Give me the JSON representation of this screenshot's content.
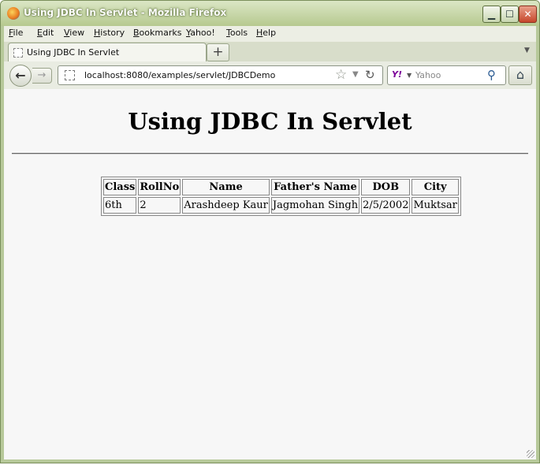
{
  "window": {
    "title": "Using JDBC In Servlet - Mozilla Firefox",
    "controls": {
      "minimize": "▁",
      "maximize": "☐",
      "close": "✕"
    }
  },
  "menu": [
    {
      "accel": "F",
      "rest": "ile"
    },
    {
      "accel": "E",
      "rest": "dit"
    },
    {
      "accel": "V",
      "rest": "iew"
    },
    {
      "accel": "H",
      "rest": "istory"
    },
    {
      "accel": "B",
      "rest": "ookmarks"
    },
    {
      "accel": "Y",
      "rest": "ahoo!"
    },
    {
      "accel": "T",
      "rest": "ools"
    },
    {
      "accel": "H",
      "rest": "elp"
    }
  ],
  "tabs": [
    {
      "title": "Using JDBC In Servlet",
      "active": true
    }
  ],
  "toolbar": {
    "new_tab_label": "+",
    "url": "localhost:8080/examples/servlet/JDBCDemo",
    "search_engine": "Y!",
    "search_placeholder": "Yahoo"
  },
  "page": {
    "heading": "Using JDBC In Servlet",
    "table": {
      "headers": [
        "Class",
        "RollNo",
        "Name",
        "Father's Name",
        "DOB",
        "City"
      ],
      "rows": [
        [
          "6th",
          "2",
          "Arashdeep Kaur",
          "Jagmohan Singh",
          "2/5/2002",
          "Muktsar"
        ]
      ]
    }
  },
  "colors": {
    "titlebar": "#b6c98f",
    "page_background": "#f7f7f7",
    "close_button": "#c7472c"
  }
}
